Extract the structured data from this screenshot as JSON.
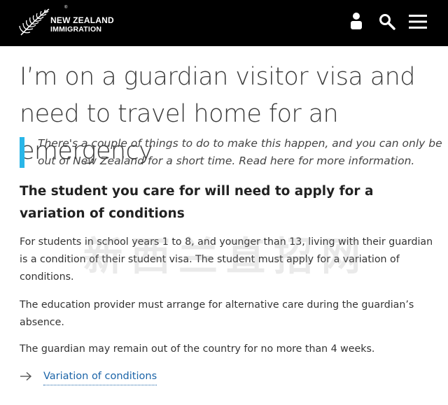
{
  "header": {
    "logo_line1": "NEW ZEALAND",
    "logo_line2": "IMMIGRATION",
    "logo_icon": "silver-fern-icon",
    "nav_icons": [
      "user-icon",
      "search-icon",
      "menu-icon"
    ],
    "background": "#000000"
  },
  "page": {
    "title": "I’m on a guardian visitor visa and need to travel home for an emergency",
    "intro": "There's a couple of things to do to make this happen, and you can only be out of New Zealand for a short time. Read here for more information.",
    "intro_bar_color": "#29b6e8",
    "subheading": "The student you care for will need to apply for a variation of conditions",
    "paragraphs": [
      "For students in school years 1 to 8, and younger than 13, living with their guardian is a condition of their student visa. The student must apply for a variation of conditions.",
      "The education provider must arrange for alternative care during the guardian’s absence.",
      "The guardian may remain out of the country for no more than 4 weeks."
    ],
    "link": {
      "icon": "arrow-right-icon",
      "label": "Variation of conditions",
      "color": "#1b64a8"
    },
    "watermark": "新西兰直招网"
  }
}
